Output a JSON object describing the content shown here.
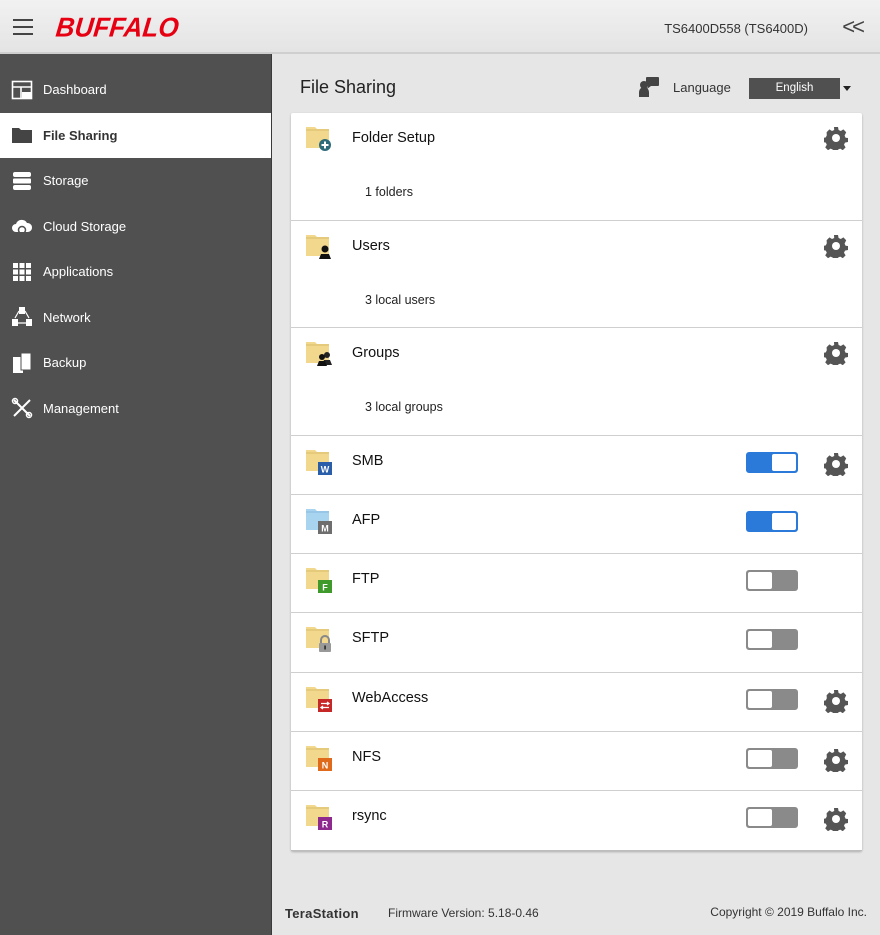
{
  "header": {
    "brand": "BUFFALO",
    "device_name": "TS6400D558 (TS6400D)",
    "collapse_glyph": "<<",
    "brand_color": "#e60012"
  },
  "sidebar": {
    "items": [
      {
        "label": "Dashboard",
        "icon": "dashboard-icon",
        "active": false
      },
      {
        "label": "File Sharing",
        "icon": "folder-icon",
        "active": true
      },
      {
        "label": "Storage",
        "icon": "storage-icon",
        "active": false
      },
      {
        "label": "Cloud Storage",
        "icon": "cloud-sync-icon",
        "active": false
      },
      {
        "label": "Applications",
        "icon": "grid-icon",
        "active": false
      },
      {
        "label": "Network",
        "icon": "network-icon",
        "active": false
      },
      {
        "label": "Backup",
        "icon": "backup-icon",
        "active": false
      },
      {
        "label": "Management",
        "icon": "tools-icon",
        "active": false
      }
    ]
  },
  "main": {
    "title": "File Sharing",
    "language_label": "Language",
    "language_value": "English",
    "rows": [
      {
        "title": "Folder Setup",
        "subtitle": "1 folders",
        "badge": "plus",
        "gear": true
      },
      {
        "title": "Users",
        "subtitle": "3 local users",
        "badge": "user",
        "gear": true
      },
      {
        "title": "Groups",
        "subtitle": "3 local groups",
        "badge": "group",
        "gear": true
      },
      {
        "title": "SMB",
        "badge": "W",
        "badge_color": "#2b5ea8",
        "toggle": "on",
        "gear": true
      },
      {
        "title": "AFP",
        "badge": "M",
        "badge_color": "#6e6e6e",
        "toggle": "on",
        "gear": false,
        "folder_color": "#a8d4f0"
      },
      {
        "title": "FTP",
        "badge": "F",
        "badge_color": "#3f9a2b",
        "toggle": "off",
        "gear": false
      },
      {
        "title": "SFTP",
        "badge": "lock",
        "toggle": "off",
        "gear": false
      },
      {
        "title": "WebAccess",
        "badge": "arrows",
        "badge_color": "#c62828",
        "toggle": "off",
        "gear": true
      },
      {
        "title": "NFS",
        "badge": "N",
        "badge_color": "#e06a1b",
        "toggle": "off",
        "gear": true
      },
      {
        "title": "rsync",
        "badge": "R",
        "badge_color": "#8e2a8e",
        "toggle": "off",
        "gear": true
      }
    ]
  },
  "footer": {
    "brand": "TeraStation",
    "firmware": "Firmware Version: 5.18-0.46",
    "copyright": "Copyright © 2019 Buffalo Inc."
  },
  "colors": {
    "toggle_on": "#2b7ad9",
    "toggle_off": "#8a8a8a",
    "sidebar_bg": "#505050"
  }
}
